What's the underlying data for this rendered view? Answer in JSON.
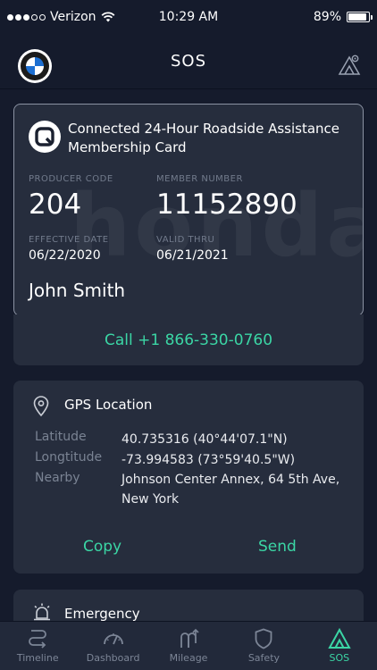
{
  "status_bar": {
    "carrier": "Verizon",
    "time": "10:29 AM",
    "battery": "89%",
    "battery_level": 0.89
  },
  "nav": {
    "title": "SOS"
  },
  "card": {
    "title": "Connected 24-Hour Roadside Assistance Membership Card",
    "watermark": "honda",
    "producer_code_label": "PRODUCER CODE",
    "producer_code": "204",
    "member_number_label": "MEMBER NUMBER",
    "member_number": "11152890",
    "effective_date_label": "EFFECTIVE DATE",
    "effective_date": "06/22/2020",
    "valid_thru_label": "VALID THRU",
    "valid_thru": "06/21/2021",
    "member_name": "John Smith"
  },
  "call": {
    "label": "Call +1 866-330-0760"
  },
  "gps": {
    "title": "GPS Location",
    "latitude_label": "Latitude",
    "latitude_value": "40.735316 (40°44'07.1\"N)",
    "longitude_label": "Longtitude",
    "longitude_value": "-73.994583 (73°59'40.5\"W)",
    "nearby_label": "Nearby",
    "nearby_value": "Johnson Center Annex, 64 5th Ave, New York",
    "copy_label": "Copy",
    "send_label": "Send"
  },
  "emergency": {
    "title": "Emergency"
  },
  "tabs": [
    {
      "label": "Timeline",
      "icon": "timeline-icon"
    },
    {
      "label": "Dashboard",
      "icon": "dashboard-icon"
    },
    {
      "label": "Mileage",
      "icon": "mileage-icon"
    },
    {
      "label": "Safety",
      "icon": "safety-icon"
    },
    {
      "label": "SOS",
      "icon": "sos-icon"
    }
  ],
  "colors": {
    "background": "#151b2c",
    "card": "#262d3d",
    "accent": "#3bd6a5",
    "muted": "#7a8393"
  }
}
